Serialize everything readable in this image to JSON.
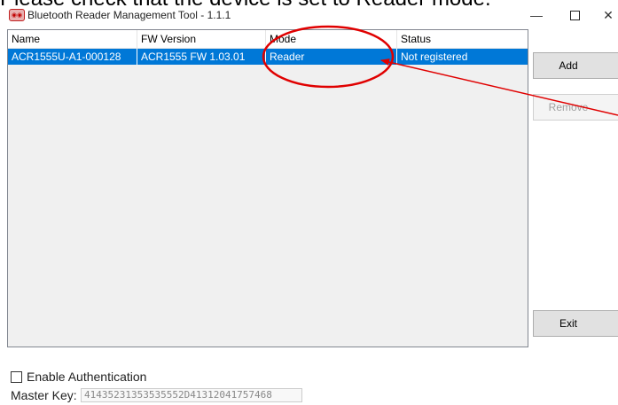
{
  "caption": "Please check that the device is set to Reader mode.",
  "window": {
    "title": "Bluetooth Reader Management Tool - 1.1.1",
    "minimize_glyph": "—",
    "close_glyph": "✕"
  },
  "list": {
    "columns": [
      "Name",
      "FW Version",
      "Mode",
      "Status"
    ],
    "rows": [
      {
        "name": "ACR1555U-A1-000128",
        "fw_version": "ACR1555 FW 1.03.01",
        "mode": "Reader",
        "status": "Not registered"
      }
    ]
  },
  "buttons": {
    "add": "Add",
    "remove": "Remove",
    "exit": "Exit"
  },
  "auth": {
    "enable_label": "Enable Authentication",
    "master_key_label": "Master Key:",
    "master_key_value": "41435231353535552D41312041757468"
  },
  "annotation": {
    "color": "#e00000"
  }
}
